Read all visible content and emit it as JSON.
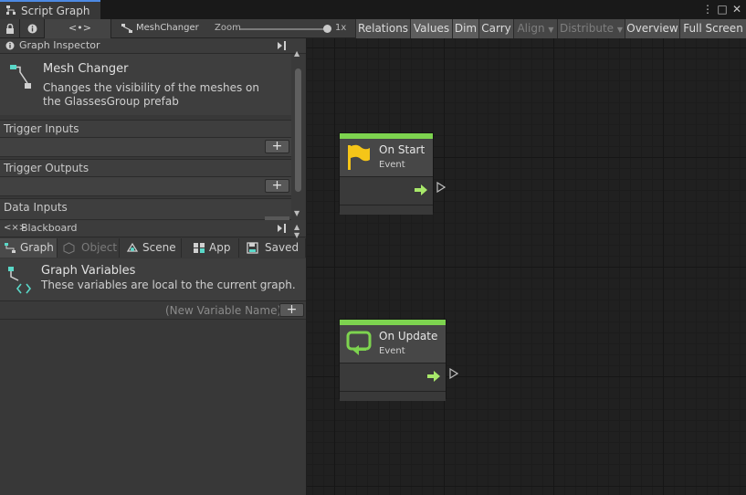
{
  "window": {
    "tab_title": "Script Graph",
    "controls": [
      "⋮",
      "□",
      "✕"
    ]
  },
  "toolbar": {
    "graph_icon_label": "<•>",
    "breadcrumb": "MeshChanger",
    "zoom_label": "Zoom",
    "zoom_value": "1x",
    "zoom_level": 1.0,
    "buttons": [
      {
        "label": "Relations",
        "state": "normal"
      },
      {
        "label": "Values",
        "state": "active"
      },
      {
        "label": "Dim",
        "state": "active"
      },
      {
        "label": "Carry",
        "state": "normal"
      },
      {
        "label": "Align",
        "state": "disabled",
        "dropdown": true
      },
      {
        "label": "Distribute",
        "state": "disabled",
        "dropdown": true
      },
      {
        "label": "Overview",
        "state": "normal"
      },
      {
        "label": "Full Screen",
        "state": "normal"
      }
    ]
  },
  "inspector": {
    "header": "Graph Inspector",
    "graph_title": "Mesh Changer",
    "graph_description": "Changes the visibility of the meshes on the GlassesGroup prefab",
    "sections": [
      {
        "label": "Trigger Inputs",
        "add": "+"
      },
      {
        "label": "Trigger Outputs",
        "add": "+"
      },
      {
        "label": "Data Inputs"
      }
    ]
  },
  "blackboard": {
    "header": "Blackboard",
    "tabs": [
      {
        "label": "Graph",
        "icon": "graph-icon",
        "active": true,
        "enabled": true
      },
      {
        "label": "Object",
        "icon": "object-icon",
        "active": false,
        "enabled": false
      },
      {
        "label": "Scene",
        "icon": "scene-icon",
        "active": false,
        "enabled": true
      },
      {
        "label": "App",
        "icon": "app-icon",
        "active": false,
        "enabled": true
      },
      {
        "label": "Saved",
        "icon": "saved-icon",
        "active": false,
        "enabled": true
      }
    ],
    "variables_title": "Graph Variables",
    "variables_description": "These variables are local to the current graph.",
    "new_variable_placeholder": "(New Variable Name)",
    "add_label": "+"
  },
  "nodes": [
    {
      "title": "On Start",
      "subtitle": "Event",
      "icon": "flag-icon",
      "accent": "#7dd34f"
    },
    {
      "title": "On Update",
      "subtitle": "Event",
      "icon": "loop-icon",
      "accent": "#7dd34f"
    }
  ],
  "colors": {
    "accent_green": "#7dd34f",
    "flag_yellow": "#f5c518",
    "tab_highlight": "#4d8ae3",
    "graph_icon": "#5ad8c8"
  }
}
